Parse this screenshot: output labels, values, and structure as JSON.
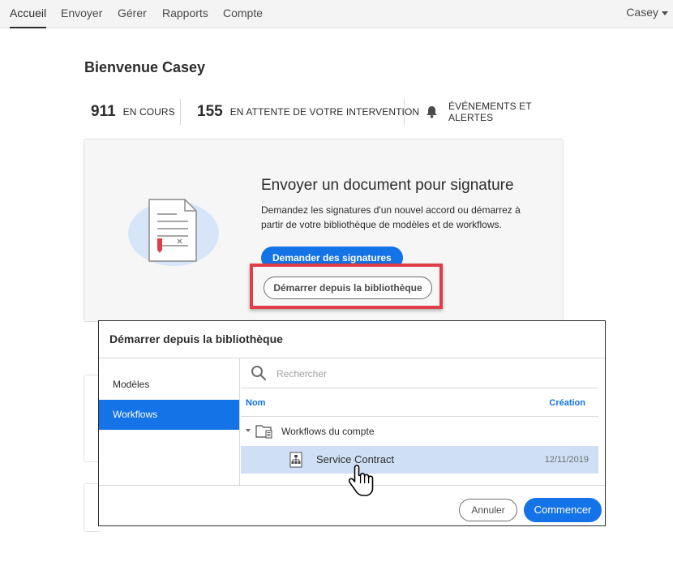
{
  "nav": {
    "items": [
      {
        "label": "Accueil",
        "active": true
      },
      {
        "label": "Envoyer",
        "active": false
      },
      {
        "label": "Gérer",
        "active": false
      },
      {
        "label": "Rapports",
        "active": false
      },
      {
        "label": "Compte",
        "active": false
      }
    ],
    "user": "Casey"
  },
  "welcome": "Bienvenue Casey",
  "stats": {
    "in_progress": {
      "count": "911",
      "label": "EN COURS"
    },
    "awaiting": {
      "count": "155",
      "label": "EN ATTENTE DE VOTRE INTERVENTION"
    },
    "events": {
      "label": "ÉVÉNEMENTS ET ALERTES",
      "icon": "bell-icon"
    }
  },
  "send_card": {
    "title": "Envoyer un document pour signature",
    "description": "Demandez les signatures d'un nouvel accord ou démarrez à partir de votre bibliothèque de modèles et de workflows.",
    "request_button": "Demander des signatures",
    "library_button": "Démarrer depuis la bibliothèque"
  },
  "dialog": {
    "title": "Démarrer depuis la bibliothèque",
    "sidebar": [
      {
        "label": "Modèles",
        "selected": false
      },
      {
        "label": "Workflows",
        "selected": true
      }
    ],
    "search_placeholder": "Rechercher",
    "columns": {
      "name": "Nom",
      "created": "Création"
    },
    "folder": "Workflows du compte",
    "items": [
      {
        "name": "Service Contract",
        "date": "12/11/2019",
        "selected": true
      }
    ],
    "cancel_button": "Annuler",
    "start_button": "Commencer"
  },
  "colors": {
    "accent": "#1473e6",
    "highlight": "#e03d4a",
    "selected_row": "#cfe0f6"
  }
}
